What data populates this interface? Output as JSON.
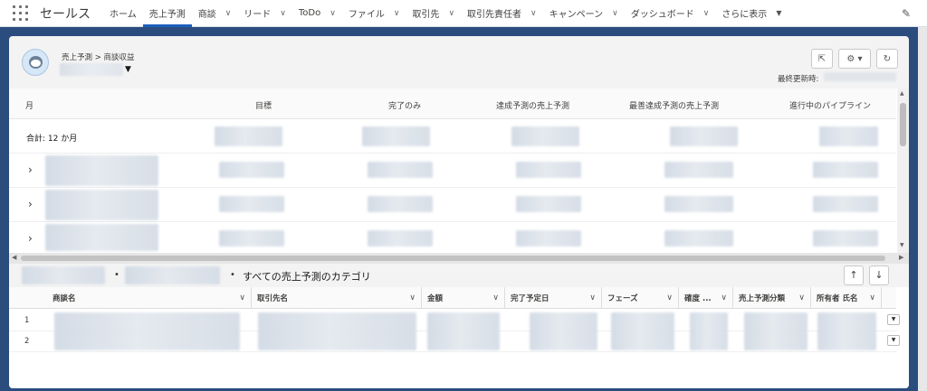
{
  "nav": {
    "app_name": "セールス",
    "tabs": [
      {
        "label": "ホーム",
        "chevron": false
      },
      {
        "label": "売上予測",
        "chevron": false,
        "active": true
      },
      {
        "label": "商談",
        "chevron": true
      },
      {
        "label": "リード",
        "chevron": true
      },
      {
        "label": "ToDo",
        "chevron": true
      },
      {
        "label": "ファイル",
        "chevron": true
      },
      {
        "label": "取引先",
        "chevron": true
      },
      {
        "label": "取引先責任者",
        "chevron": true
      },
      {
        "label": "キャンペーン",
        "chevron": true
      },
      {
        "label": "ダッシュボード",
        "chevron": true
      },
      {
        "label": "さらに表示",
        "triangle": true
      }
    ],
    "chevron_glyph": "∨",
    "triangle_glyph": "▼",
    "edit_icon": "✎"
  },
  "header": {
    "breadcrumb": "売上予測 > 商談収益",
    "dropdown_glyph": "▼",
    "share_icon": "⇱",
    "gear_label": "⚙ ▾",
    "refresh_icon": "↻",
    "last_updated_label": "最終更新時:"
  },
  "forecast": {
    "columns": [
      "月",
      "目標",
      "完了のみ",
      "達成予測の売上予測",
      "最善達成予測の売上予測",
      "進行中のパイプライン"
    ],
    "total_label": "合計: 12 か月",
    "expand_glyph": "›"
  },
  "filter": {
    "bullet": "•",
    "label": "すべての売上予測のカテゴリ",
    "up": "↑",
    "down": "↓"
  },
  "opportunities": {
    "columns": [
      "商談名",
      "取引先名",
      "金額",
      "完了予定日",
      "フェーズ",
      "確度 ...",
      "売上予測分類",
      "所有者 氏名"
    ],
    "dropdown_glyph": "∨",
    "rows": [
      "1",
      "2"
    ],
    "row_menu_glyph": "▼"
  },
  "colors": {
    "accent": "#1b5fbe",
    "brand_band": "#2a4d7e"
  }
}
